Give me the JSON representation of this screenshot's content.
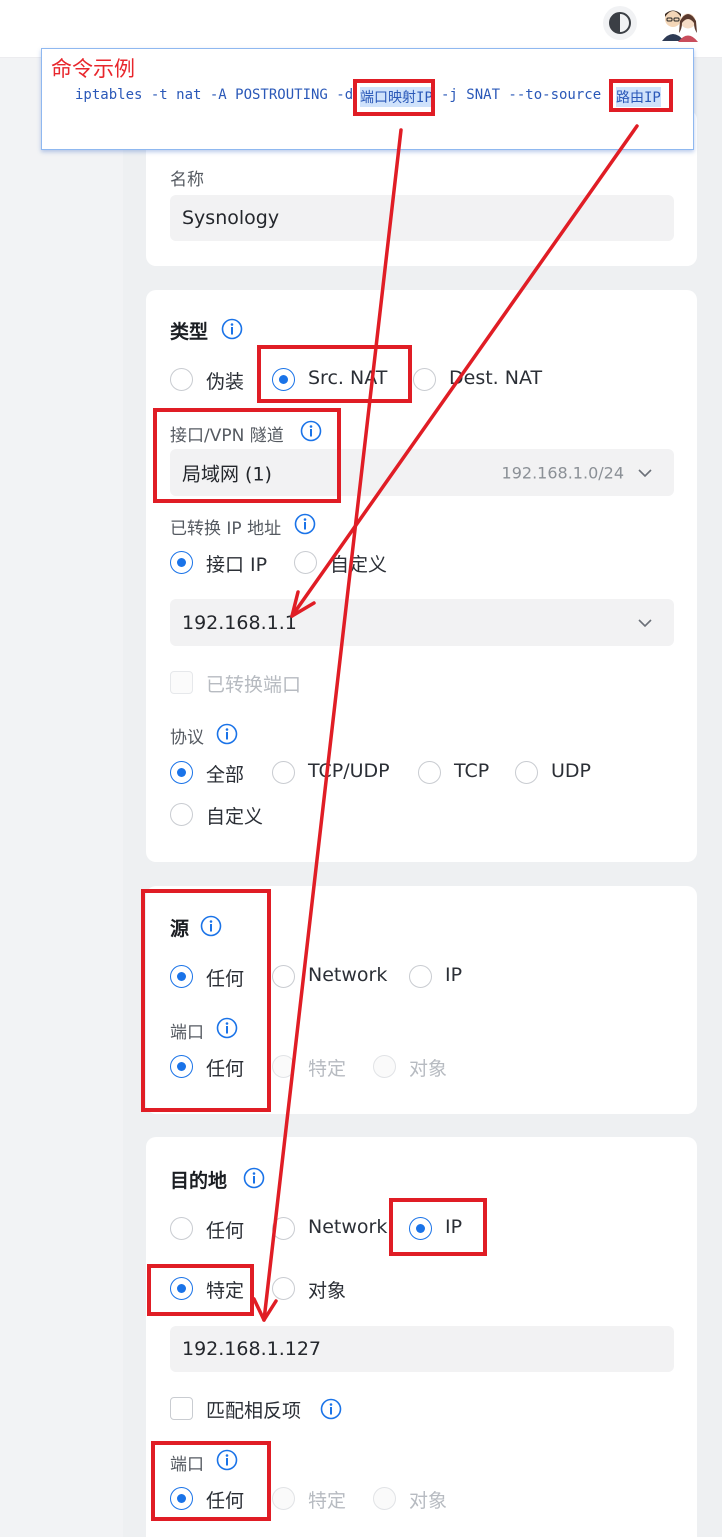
{
  "callout": {
    "title": "命令示例",
    "cmd_1": "iptables -t nat -A POSTROUTING -d ",
    "cmd_port_ip": "端口映射IP",
    "cmd_2": " -j SNAT --to-source ",
    "cmd_route_ip": "路由IP"
  },
  "name_section": {
    "label": "名称",
    "value": "Sysnology"
  },
  "type_section": {
    "title": "类型",
    "options": [
      "伪装",
      "Src. NAT",
      "Dest. NAT"
    ],
    "selected": "Src. NAT",
    "interface_label": "接口/VPN 隧道",
    "interface_value": "局域网 (1)",
    "interface_subnet": "192.168.1.0/24",
    "translated_ip_label": "已转换 IP 地址",
    "translated_ip_options": [
      "接口 IP",
      "自定义"
    ],
    "translated_ip_selected": "接口 IP",
    "ip_value": "192.168.1.1",
    "translated_port_label": "已转换端口",
    "protocol_label": "协议",
    "protocol_options": [
      "全部",
      "TCP/UDP",
      "TCP",
      "UDP",
      "自定义"
    ],
    "protocol_selected": "全部"
  },
  "source_section": {
    "title": "源",
    "options": [
      "任何",
      "Network",
      "IP"
    ],
    "selected": "任何",
    "port_label": "端口",
    "port_options": [
      "任何",
      "特定",
      "对象"
    ],
    "port_selected": "任何"
  },
  "destination_section": {
    "title": "目的地",
    "options": [
      "任何",
      "Network",
      "IP"
    ],
    "selected": "IP",
    "ip_mode_options": [
      "特定",
      "对象"
    ],
    "ip_mode_selected": "特定",
    "ip_value": "192.168.1.127",
    "match_inverse_label": "匹配相反项",
    "port_label": "端口",
    "port_options": [
      "任何",
      "特定",
      "对象"
    ],
    "port_selected": "任何"
  },
  "colors": {
    "accent": "#1a73e8",
    "annotation_red": "#e01d25"
  },
  "icons": {
    "theme_toggle": "contrast-icon",
    "user": "avatar-icon",
    "info": "info-icon",
    "dropdown": "chevron-down-icon"
  }
}
